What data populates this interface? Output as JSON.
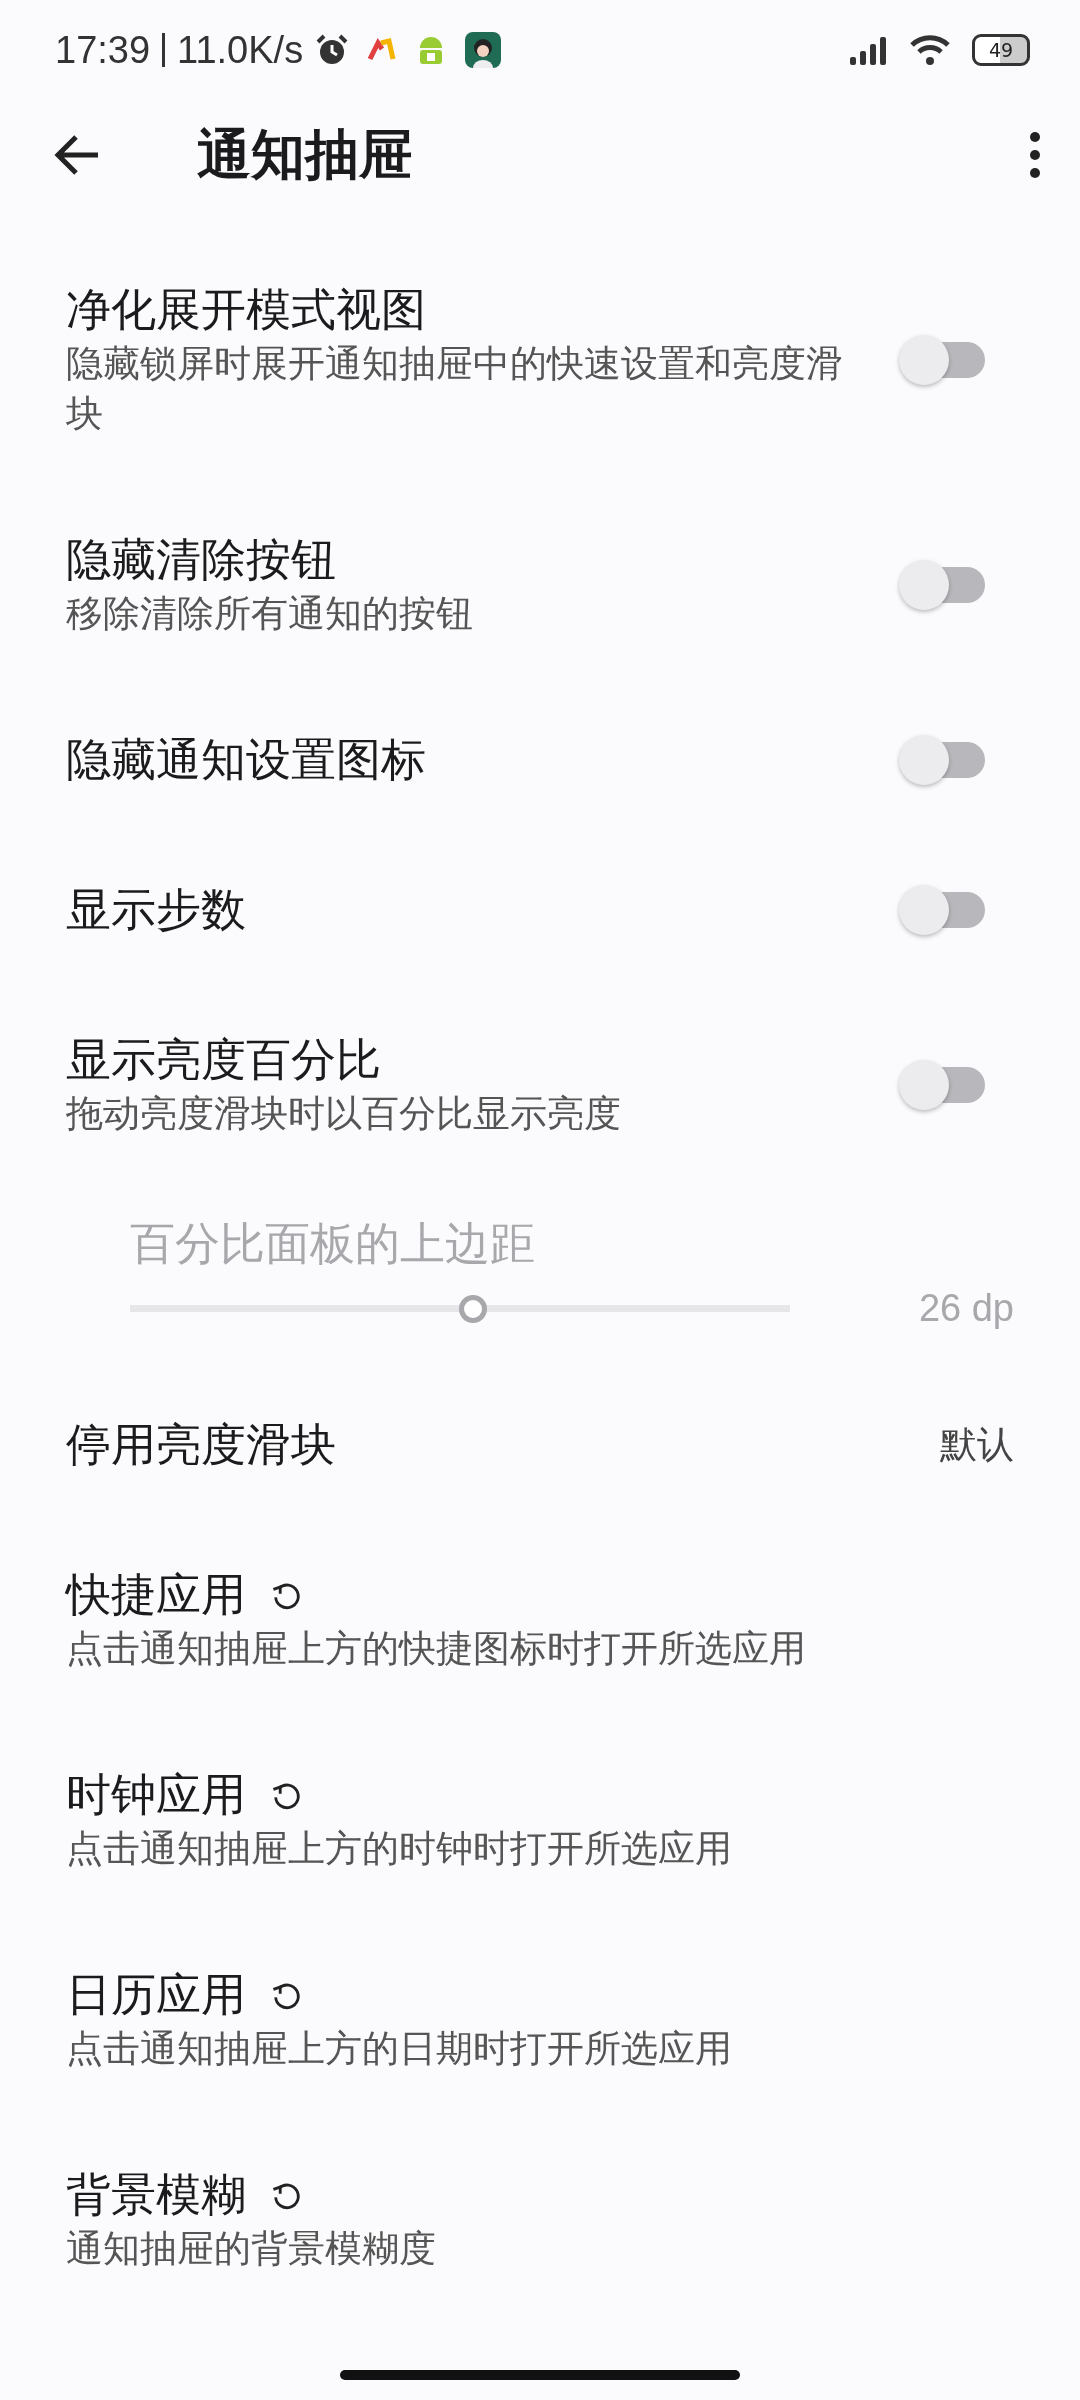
{
  "status_bar": {
    "time": "17:39",
    "speed": "11.0K/s",
    "battery": "49"
  },
  "app_bar": {
    "title": "通知抽屉"
  },
  "items": [
    {
      "kind": "switch",
      "title": "净化展开模式视图",
      "subtitle": "隐藏锁屏时展开通知抽屉中的快速设置和亮度滑块",
      "on": false,
      "resettable": false
    },
    {
      "kind": "switch",
      "title": "隐藏清除按钮",
      "subtitle": "移除清除所有通知的按钮",
      "on": false,
      "resettable": false
    },
    {
      "kind": "switch",
      "title": "隐藏通知设置图标",
      "on": false,
      "resettable": false
    },
    {
      "kind": "switch",
      "title": "显示步数",
      "on": false,
      "resettable": false
    },
    {
      "kind": "switch",
      "title": "显示亮度百分比",
      "subtitle": "拖动亮度滑块时以百分比显示亮度",
      "on": false,
      "resettable": false
    },
    {
      "kind": "slider",
      "title": "百分比面板的上边距",
      "level": 0.52,
      "reading": "26 dp",
      "disabled": true,
      "resettable": false
    },
    {
      "kind": "value",
      "title": "停用亮度滑块",
      "value": "默认",
      "resettable": false
    },
    {
      "kind": "link",
      "title": "快捷应用",
      "subtitle": "点击通知抽屉上方的快捷图标时打开所选应用",
      "resettable": true
    },
    {
      "kind": "link",
      "title": "时钟应用",
      "subtitle": "点击通知抽屉上方的时钟时打开所选应用",
      "resettable": true
    },
    {
      "kind": "link",
      "title": "日历应用",
      "subtitle": "点击通知抽屉上方的日期时打开所选应用",
      "resettable": true
    },
    {
      "kind": "link",
      "title": "背景模糊",
      "subtitle": "通知抽屉的背景模糊度",
      "resettable": true
    }
  ]
}
